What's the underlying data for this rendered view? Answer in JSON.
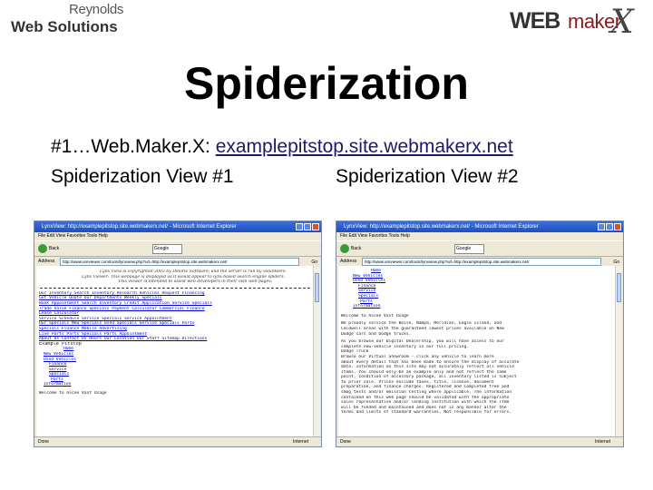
{
  "header": {
    "logo_left_top": "Reynolds",
    "logo_left_bottom": "Web Solutions",
    "logo_right_web": "WEB",
    "logo_right_maker": "maker",
    "logo_right_x": "X"
  },
  "slide": {
    "title": "Spiderization",
    "line1_prefix": "#1…Web.Maker.X: ",
    "line1_url": "examplepitstop.site.webmakerx.net",
    "view1_label": "Spiderization View #1",
    "view2_label": "Spiderization View #2"
  },
  "browser1": {
    "window_title": "LynxView: http://examplepitstop.site.webmakerx.net/ - Microsoft Internet Explorer",
    "menu": "File   Edit   View   Favorites   Tools   Help",
    "toolbar_back": "Back",
    "google_label": "Google",
    "address_label": "Address",
    "address_value": "http://www.ureviewer.com/tools/lynxview.php?url=http://examplepitstop.site.webmakerx.net/",
    "go_label": "Go",
    "notes": [
      "Lynx View is copyrighted 2003 by Delorie Software; and the server is run by volunteers.",
      "Lynx Viewer: This webpage is displayed as it would appear to lynx-based search engine spiders.",
      "This viewer is intended to assist web developers in their own web pages."
    ],
    "links": [
      "Our Inventory  Search Inventory  Research Vehicles  Request Financing",
      "Get Vehicle Quote  Our Departments  Weekly Specials",
      "Book Appointment  Search Inventory  Credit Application  Service Specials",
      "Trade Value  Finance Specials  Payment Calculator  Commercial Finance",
      "Lease Calculator",
      "Service Schedule  Service Specials  Service Appointment",
      "Our Specials  New Specials  Used Specials  Service Specials  Parts",
      "Specials  Finance  Mobile Advertising",
      "Live Parts  Parts Specials  Parts Appointment",
      "About Us  Contact Us  Hours  Our Location  Our Staff  Sitemap  Directions"
    ],
    "subheading": "Example Pitstop",
    "sub_links": [
      "Home",
      "New Vehicles",
      "Used Vehicles",
      "Finance",
      "Service",
      "Specials",
      "Parts",
      "Information"
    ],
    "welcome": "Welcome to Ascee Vast Usage",
    "status_left": "Done",
    "status_zone": "Internet"
  },
  "browser2": {
    "window_title": "LynxView: http://examplepitstop.site.webmakerx.net/ - Microsoft Internet Explorer",
    "menu": "File   Edit   View   Favorites   Tools   Help",
    "toolbar_back": "Back",
    "google_label": "Google",
    "address_label": "Address",
    "address_value": "http://www.ureviewer.com/tools/lynxview.php?url=http://examplepitstop.site.webmakerx.net/",
    "go_label": "Go",
    "top_links": [
      "Home",
      "New Vehicles",
      "Used Vehicles",
      "Finance",
      "Service",
      "Specials",
      "Parts",
      "Information"
    ],
    "paragraphs": [
      "Welcome to Ascee Vast Usage",
      "We proudly service the Boise, Nampa, Meridian, Eagle Island, and",
      "Caldwell areas with the guaranteed lowest prices available on New",
      "Dodge cars and Dodge trucks.",
      "",
      "As you browse our Digital Dealership, you will have access to our",
      "complete new-vehicle inventory in our full pricing.",
      "Dodge Truck",
      "Browse our Virtual Showroom - click any vehicle to learn more",
      "about every detail that has been made to ensure the display of accurate",
      "data. Information on this site may not accurately reflect all vehicle",
      "items. You should only be an example only and not reflect the same",
      "point, condition of accessory package, all inventory listed is subject",
      "to prior sale. Prices exclude taxes, title, license, document",
      "preparation, and finance charges. Registered and Completed free and",
      "smog tests and/or emission testing where applicable. The information",
      "contained on this web page should be validated with the appropriate",
      "sales representative and/or lending institution with which the item",
      "will be funded and maintained and does not in any manner alter the",
      "terms and limits of standard warranties. Not responsible for errors."
    ],
    "status_left": "Done",
    "status_zone": "Internet"
  }
}
